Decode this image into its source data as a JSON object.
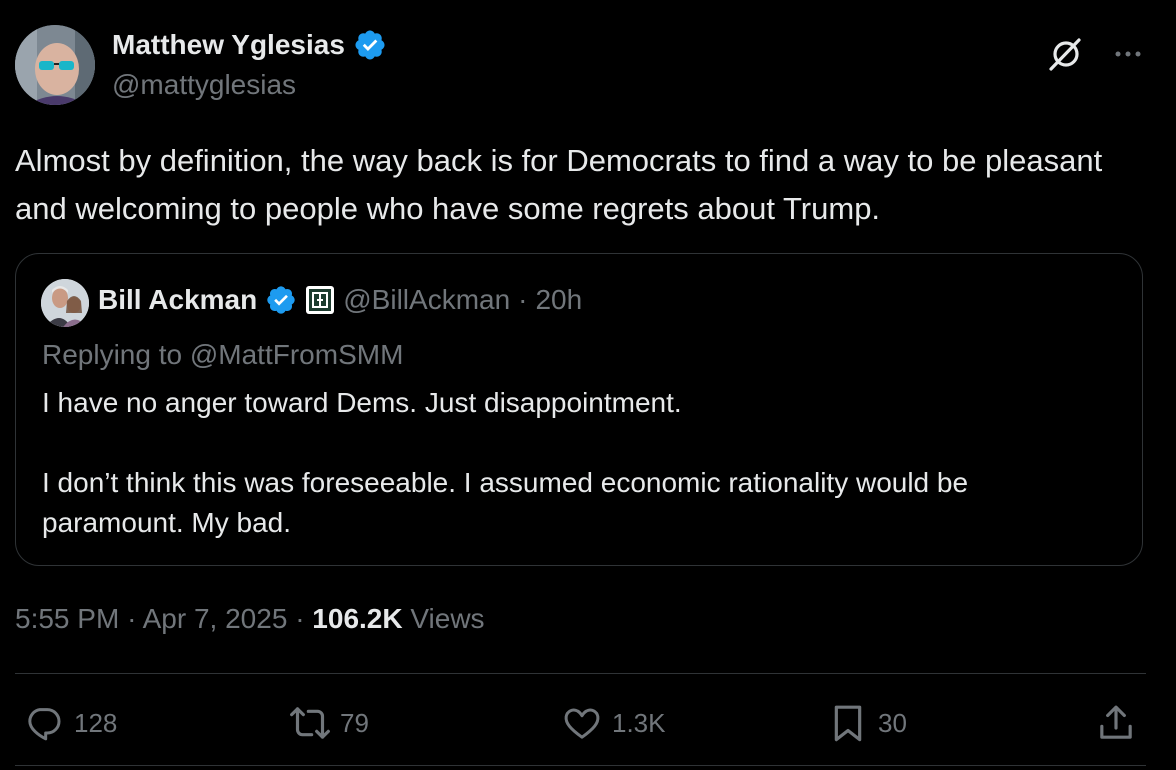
{
  "tweet": {
    "author_name": "Matthew Yglesias",
    "author_handle": "@mattyglesias",
    "text": "Almost by definition, the way back is for Democrats to find a way to be pleasant and welcoming to people who have some regrets about Trump.",
    "time": "5:55 PM",
    "separator": "·",
    "date": "Apr 7, 2025",
    "views_count": "106.2K",
    "views_label": "Views"
  },
  "quoted": {
    "author_name": "Bill Ackman",
    "author_handle": "@BillAckman",
    "separator": "·",
    "time_ago": "20h",
    "replying_to": "Replying to @MattFromSMM",
    "text_line1": "I have no anger toward Dems. Just disappointment.",
    "text_line2": "I don’t think this was foreseeable. I assumed economic rationality would be paramount. My bad."
  },
  "actions": {
    "replies": "128",
    "reposts": "79",
    "likes": "1.3K",
    "bookmarks": "30"
  },
  "icons": {
    "verified": "verified-badge-icon",
    "affiliation": "affiliation-badge-icon",
    "grok": "grok-icon",
    "more": "more-icon",
    "reply": "reply-icon",
    "repost": "repost-icon",
    "like": "like-icon",
    "bookmark": "bookmark-icon",
    "share": "share-icon"
  },
  "colors": {
    "background": "#000000",
    "text": "#e7e9ea",
    "muted": "#71767b",
    "verified": "#1d9bf0",
    "border": "#2f3336"
  }
}
